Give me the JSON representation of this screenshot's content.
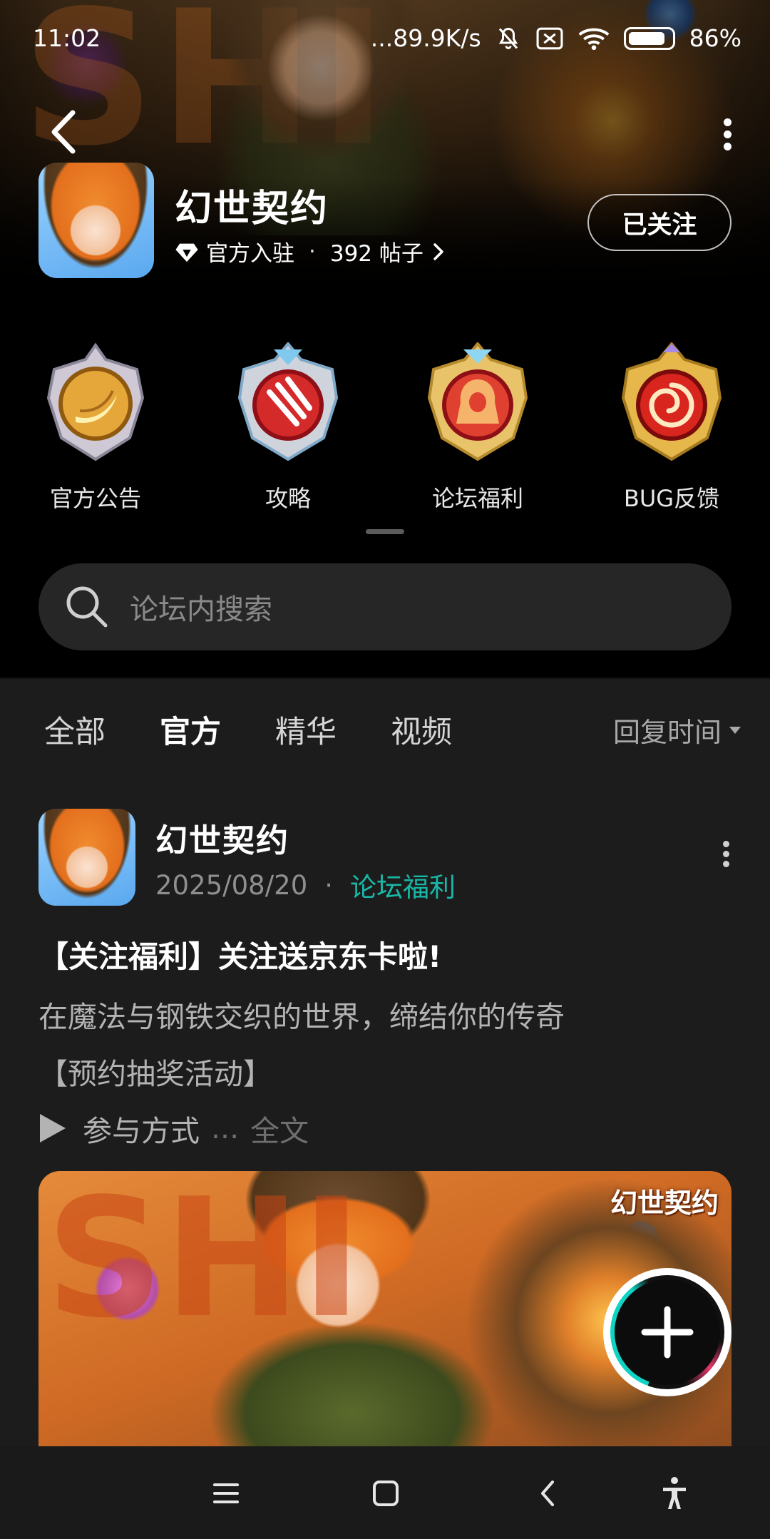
{
  "status_bar": {
    "time": "11:02",
    "network_speed": "...89.9K/s",
    "battery": "86%"
  },
  "forum": {
    "title": "幻世契约",
    "official_label": "官方入驻",
    "separator": "·",
    "posts": "392 帖子",
    "follow_label": "已关注"
  },
  "categories": [
    {
      "label": "官方公告",
      "icon": "banana-badge-icon"
    },
    {
      "label": "攻略",
      "icon": "claw-badge-icon"
    },
    {
      "label": "论坛福利",
      "icon": "hooded-figure-badge-icon"
    },
    {
      "label": "BUG反馈",
      "icon": "spiral-badge-icon"
    }
  ],
  "search": {
    "placeholder": "论坛内搜索"
  },
  "tabs": {
    "items": [
      "全部",
      "官方",
      "精华",
      "视频"
    ],
    "active_index": 1,
    "sort_label": "回复时间"
  },
  "post": {
    "author": "幻世契约",
    "date": "2025/08/20",
    "separator": "·",
    "category": "论坛福利",
    "title": "【关注福利】关注送京东卡啦!",
    "line1": "在魔法与钢铁交织的世界，缔结你的传奇",
    "line2": "【预约抽奖活动】",
    "line3": "参与方式",
    "ellipsis": "...",
    "full_text_link": "全文",
    "image_logo_text": "幻世契约"
  },
  "colors": {
    "accent": "#19b7a6",
    "background": "#1c1c1c",
    "header_bg": "#000000"
  }
}
